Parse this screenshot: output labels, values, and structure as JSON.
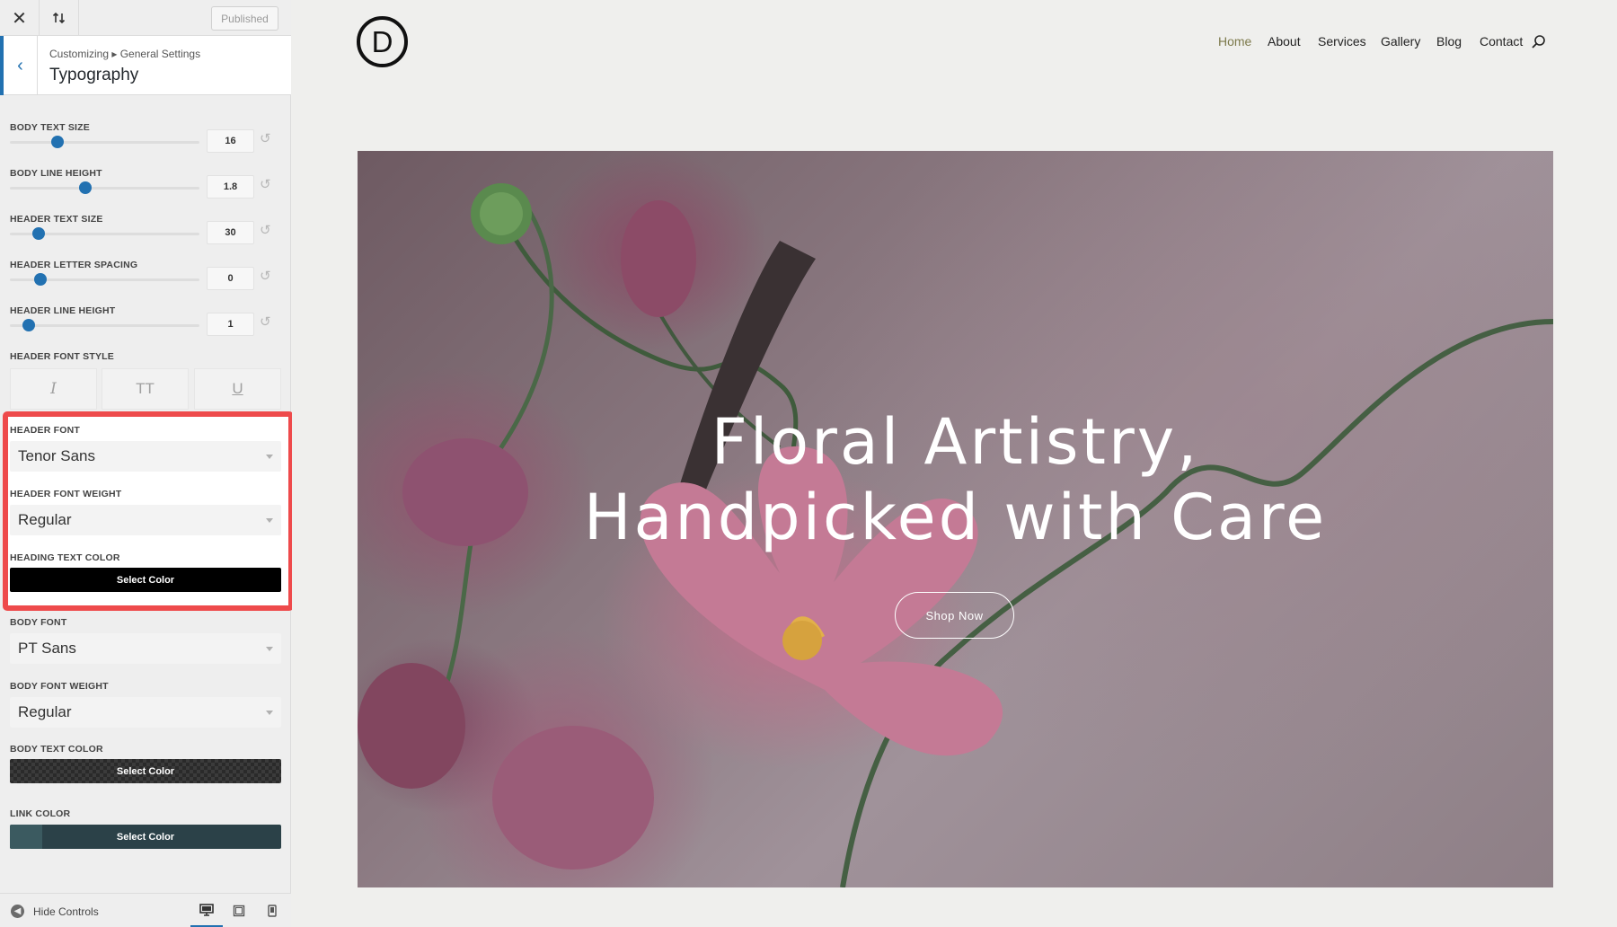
{
  "customizer": {
    "published_label": "Published",
    "breadcrumb": "Customizing ▸ General Settings",
    "section_title": "Typography",
    "sliders": [
      {
        "label": "BODY TEXT SIZE",
        "value": "16",
        "fraction": 0.25
      },
      {
        "label": "BODY LINE HEIGHT",
        "value": "1.8",
        "fraction": 0.4
      },
      {
        "label": "HEADER TEXT SIZE",
        "value": "30",
        "fraction": 0.15
      },
      {
        "label": "HEADER LETTER SPACING",
        "value": "0",
        "fraction": 0.16
      },
      {
        "label": "HEADER LINE HEIGHT",
        "value": "1",
        "fraction": 0.1
      }
    ],
    "header_font_style": {
      "label": "HEADER FONT STYLE",
      "buttons": [
        "I",
        "TT",
        "U"
      ]
    },
    "header_font": {
      "label": "HEADER FONT",
      "value": "Tenor Sans"
    },
    "header_font_weight": {
      "label": "HEADER FONT WEIGHT",
      "value": "Regular"
    },
    "heading_text_color": {
      "label": "HEADING TEXT COLOR",
      "button": "Select Color",
      "color": "#000000"
    },
    "body_font": {
      "label": "BODY FONT",
      "value": "PT Sans"
    },
    "body_font_weight": {
      "label": "BODY FONT WEIGHT",
      "value": "Regular"
    },
    "body_text_color": {
      "label": "BODY TEXT COLOR",
      "button": "Select Color"
    },
    "link_color": {
      "label": "LINK COLOR",
      "button": "Select Color",
      "color": "#2b4148"
    },
    "footer": {
      "hide_controls": "Hide Controls"
    }
  },
  "site": {
    "logo_letter": "D",
    "nav": [
      "Home",
      "About",
      "Services",
      "Gallery",
      "Blog",
      "Contact"
    ],
    "active_nav": "Home",
    "hero": {
      "title_line1": "Floral Artistry,",
      "title_line2": "Handpicked with Care",
      "cta": "Shop Now"
    }
  },
  "colors": {
    "accent": "#2271b1",
    "highlight": "#ee4a4b",
    "nav_active": "#7d7a4c"
  }
}
